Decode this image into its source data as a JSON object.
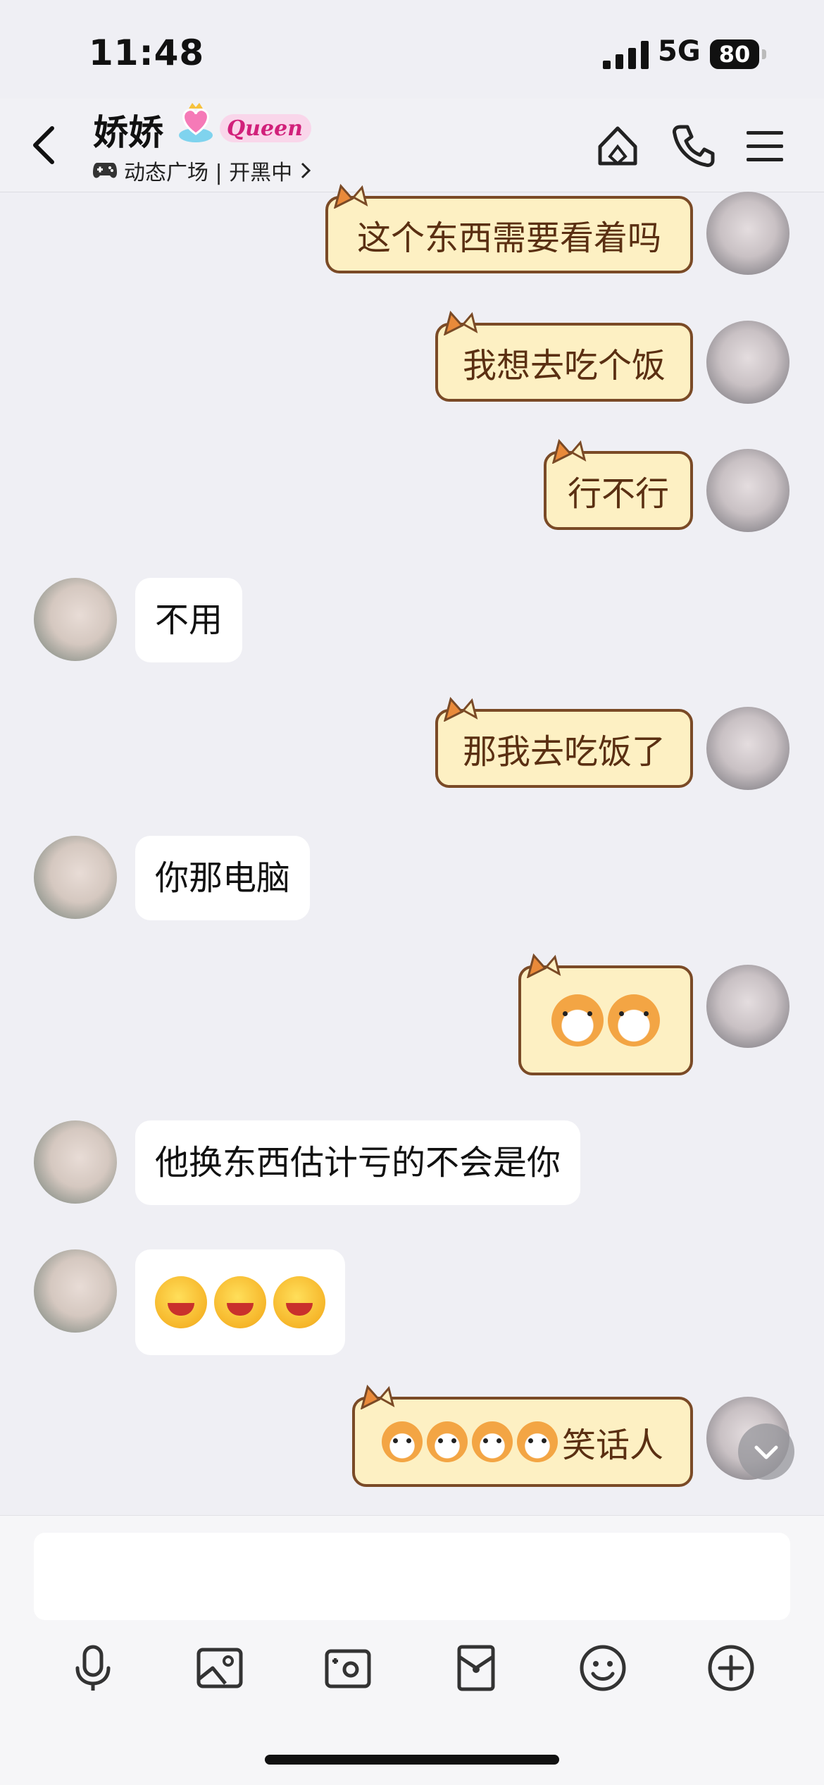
{
  "status_bar": {
    "time": "11:48",
    "network": "5G",
    "battery": "80"
  },
  "header": {
    "title": "娇娇",
    "badge_text": "Queen",
    "subtitle": "动态广场 | 开黑中",
    "icons": [
      "back-icon",
      "home-icon",
      "phone-icon",
      "menu-icon"
    ]
  },
  "messages": [
    {
      "sender": "me",
      "text": "这个东西需要看着吗"
    },
    {
      "sender": "me",
      "text": "我想去吃个饭"
    },
    {
      "sender": "me",
      "text": "行不行"
    },
    {
      "sender": "them",
      "text": "不用"
    },
    {
      "sender": "me",
      "text": "那我去吃饭了"
    },
    {
      "sender": "them",
      "text": "你那电脑"
    },
    {
      "sender": "me",
      "emoji": "shiba-emoji x2"
    },
    {
      "sender": "them",
      "text": "他换东西估计亏的不会是你"
    },
    {
      "sender": "them",
      "emoji": "laughing-emoji x3"
    },
    {
      "sender": "me",
      "text": "笑话人",
      "emoji_prefix": "shiba-emoji x4"
    }
  ],
  "input": {
    "placeholder": "",
    "tools": [
      "mic-icon",
      "image-icon",
      "camera-icon",
      "red-packet-icon",
      "emoji-icon",
      "plus-icon"
    ]
  },
  "colors": {
    "background": "#efeff4",
    "my_bubble": "#fdf0c3",
    "my_bubble_border": "#7a4a26",
    "their_bubble": "#ffffff"
  }
}
